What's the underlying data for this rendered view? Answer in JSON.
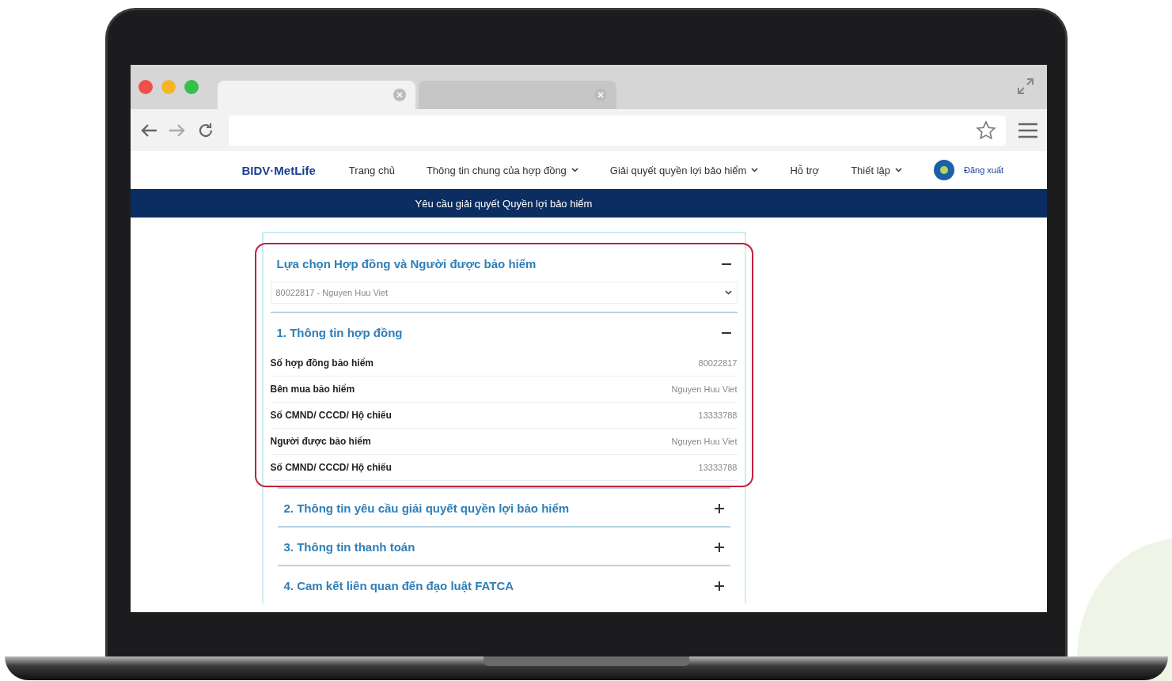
{
  "browser": {
    "tabs": [
      {
        "selected": true
      },
      {
        "selected": false
      }
    ]
  },
  "nav": {
    "logo": "BIDV·MetLife",
    "items": [
      {
        "label": "Trang chủ",
        "dropdown": false
      },
      {
        "label": "Thông tin chung của hợp đồng",
        "dropdown": true
      },
      {
        "label": "Giải quyết quyền lợi bảo hiểm",
        "dropdown": true
      },
      {
        "label": "Hỗ trợ",
        "dropdown": false
      },
      {
        "label": "Thiết lập",
        "dropdown": true
      }
    ],
    "logout": "Đăng xuất"
  },
  "banner": "Yêu cầu giải quyết Quyền lợi bảo hiểm",
  "blocks": [
    {
      "kind": "picker",
      "title": "Lựa chọn Hợp đồng và Người được bảo hiểm",
      "expanded": true,
      "highlighted": true,
      "value": "80022817 - Nguyen Huu Viet"
    },
    {
      "kind": "section",
      "title": "1. Thông tin hợp đồng",
      "expanded": true,
      "highlighted": true,
      "rows": [
        {
          "label": "Số hợp đồng bảo hiểm",
          "value": "80022817"
        },
        {
          "label": "Bên mua bảo hiểm",
          "value": "Nguyen Huu Viet"
        },
        {
          "label": "Số CMND/ CCCD/ Hộ chiếu",
          "value": "13333788"
        },
        {
          "label": "Người được bảo hiểm",
          "value": "Nguyen Huu Viet"
        },
        {
          "label": "Số CMND/ CCCD/ Hộ chiếu",
          "value": "13333788"
        }
      ]
    },
    {
      "kind": "section",
      "title": "2. Thông tin yêu cầu giải quyết quyền lợi bảo hiểm",
      "expanded": false,
      "highlighted": false
    },
    {
      "kind": "section",
      "title": "3. Thông tin thanh toán",
      "expanded": false,
      "highlighted": false
    },
    {
      "kind": "section",
      "title": "4. Cam kết liên quan đến đạo luật FATCA",
      "expanded": false,
      "highlighted": false
    }
  ]
}
